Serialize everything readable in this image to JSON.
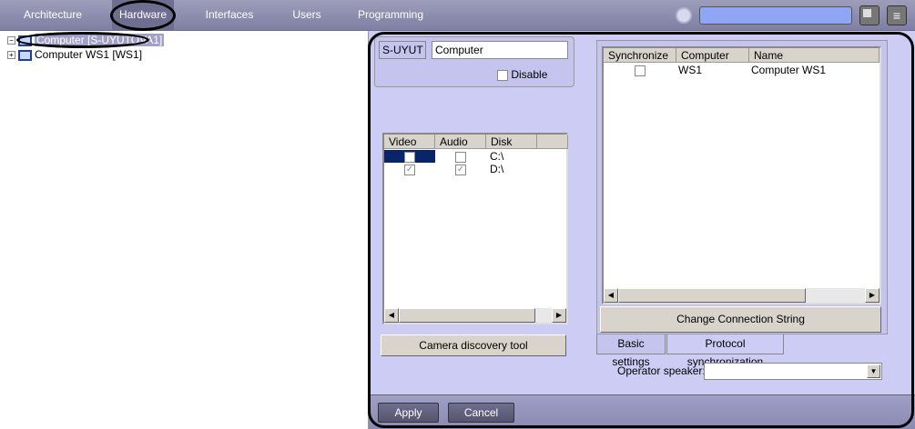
{
  "topnav": {
    "tabs": [
      "Architecture",
      "Hardware",
      "Interfaces",
      "Users",
      "Programming"
    ],
    "active": "Hardware",
    "search_value": ""
  },
  "tree": {
    "items": [
      {
        "label": "Computer [S-UYUTOVA1]",
        "expander": "⊟",
        "selected": true
      },
      {
        "label": "Computer WS1 [WS1]",
        "expander": "⊞",
        "selected": false
      }
    ]
  },
  "general": {
    "id": "S-UYUT",
    "name": "Computer",
    "disable_label": "Disable",
    "disable_checked": false
  },
  "disks": {
    "columns": [
      "Video",
      "Audio",
      "Disk"
    ],
    "rows": [
      {
        "video": false,
        "audio": false,
        "disk": "C:\\"
      },
      {
        "video": true,
        "audio": true,
        "disk": "D:\\"
      }
    ],
    "check_mark": "✓"
  },
  "camera_discovery_label": "Camera discovery tool",
  "sync": {
    "columns": [
      "Synchronize",
      "Computer",
      "Name"
    ],
    "rows": [
      {
        "synchronize": false,
        "computer": "WS1",
        "name": "Computer WS1"
      }
    ],
    "change_label": "Change Connection String"
  },
  "tabs": {
    "basic": "Basic settings",
    "protocol": "Protocol synchronization",
    "active": "Protocol synchronization"
  },
  "operator_speaker": {
    "label": "Operator speaker:",
    "value": ""
  },
  "footer": {
    "apply": "Apply",
    "cancel": "Cancel"
  },
  "colors": {
    "panel": "#ccccf5",
    "selection": "#0a246a",
    "topbar": "#8f8fb0"
  }
}
